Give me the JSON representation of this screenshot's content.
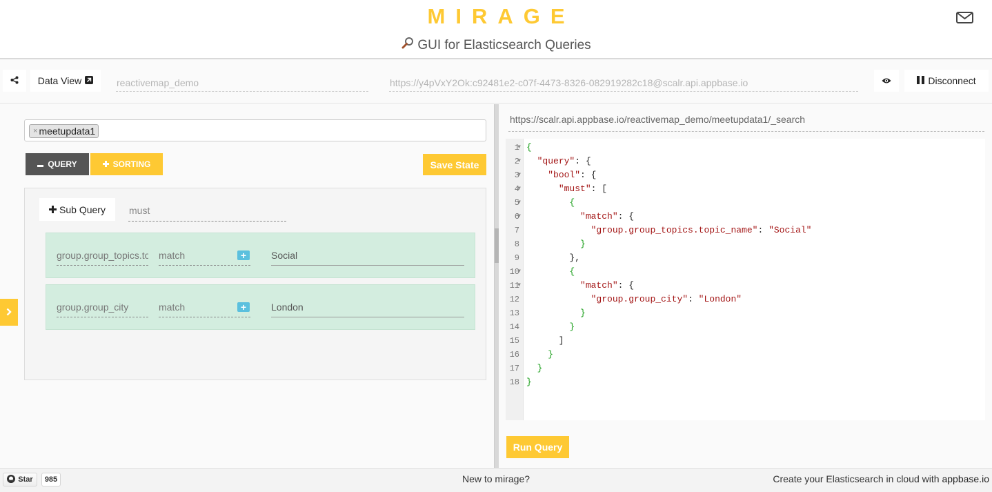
{
  "header": {
    "logo": "MIRAGE",
    "tagline": "GUI for Elasticsearch Queries"
  },
  "config": {
    "data_view_label": "Data View",
    "app_name": "reactivemap_demo",
    "url": "https://y4pVxY2Ok:c92481e2-c07f-4473-8326-082919282c18@scalr.api.appbase.io",
    "disconnect_label": "Disconnect"
  },
  "query_builder": {
    "types": [
      "meetupdata1"
    ],
    "query_tab_label": "QUERY",
    "sorting_tab_label": "SORTING",
    "save_state_label": "Save State",
    "sub_query_label": "Sub Query",
    "bool_clause": "must",
    "rows": [
      {
        "field": "group.group_topics.topic_name",
        "operator": "match",
        "value": "Social"
      },
      {
        "field": "group.group_city",
        "operator": "match",
        "value": "London"
      }
    ]
  },
  "result": {
    "endpoint": "https://scalr.api.appbase.io/reactivemap_demo/meetupdata1/_search",
    "run_query_label": "Run Query",
    "code_lines": [
      {
        "n": "1",
        "fold": true
      },
      {
        "n": "2",
        "fold": true
      },
      {
        "n": "3",
        "fold": true
      },
      {
        "n": "4",
        "fold": true
      },
      {
        "n": "5",
        "fold": true
      },
      {
        "n": "6",
        "fold": true
      },
      {
        "n": "7",
        "fold": false
      },
      {
        "n": "8",
        "fold": false
      },
      {
        "n": "9",
        "fold": false
      },
      {
        "n": "10",
        "fold": true
      },
      {
        "n": "11",
        "fold": true
      },
      {
        "n": "12",
        "fold": false
      },
      {
        "n": "13",
        "fold": false
      },
      {
        "n": "14",
        "fold": false
      },
      {
        "n": "15",
        "fold": false
      },
      {
        "n": "16",
        "fold": false
      },
      {
        "n": "17",
        "fold": false
      },
      {
        "n": "18",
        "fold": false
      }
    ],
    "code_text": [
      "{",
      "  \"query\": {",
      "    \"bool\": {",
      "      \"must\": [",
      "        {",
      "          \"match\": {",
      "            \"group.group_topics.topic_name\": \"Social\"",
      "          }",
      "        },",
      "        {",
      "          \"match\": {",
      "            \"group.group_city\": \"London\"",
      "          }",
      "        }",
      "      ]",
      "    }",
      "  }",
      "}"
    ]
  },
  "footer": {
    "star_label": "Star",
    "star_count": "985",
    "new_to": "New to mirage?",
    "create_prefix": "Create your Elasticsearch in cloud with",
    "create_link": "appbase.io"
  },
  "colors": {
    "accent": "#fec933",
    "dark_button": "#555555",
    "row_bg": "#d3eddf",
    "plus_button": "#5bc0de"
  }
}
